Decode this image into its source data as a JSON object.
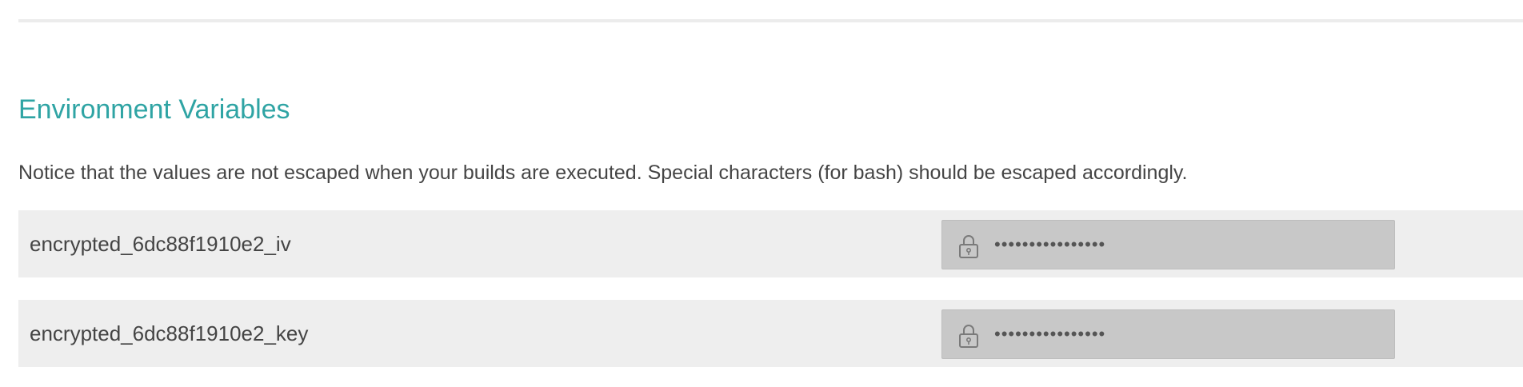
{
  "section": {
    "title": "Environment Variables",
    "notice": "Notice that the values are not escaped when your builds are executed. Special characters (for bash) should be escaped accordingly."
  },
  "env_vars": [
    {
      "name": "encrypted_6dc88f1910e2_iv",
      "masked_value": "••••••••••••••••",
      "icon": "lock-icon"
    },
    {
      "name": "encrypted_6dc88f1910e2_key",
      "masked_value": "••••••••••••••••",
      "icon": "lock-icon"
    }
  ],
  "colors": {
    "title": "#2fa4a4",
    "row_bg": "#eeeeee",
    "value_bg": "#c8c8c8",
    "text": "#444444"
  }
}
